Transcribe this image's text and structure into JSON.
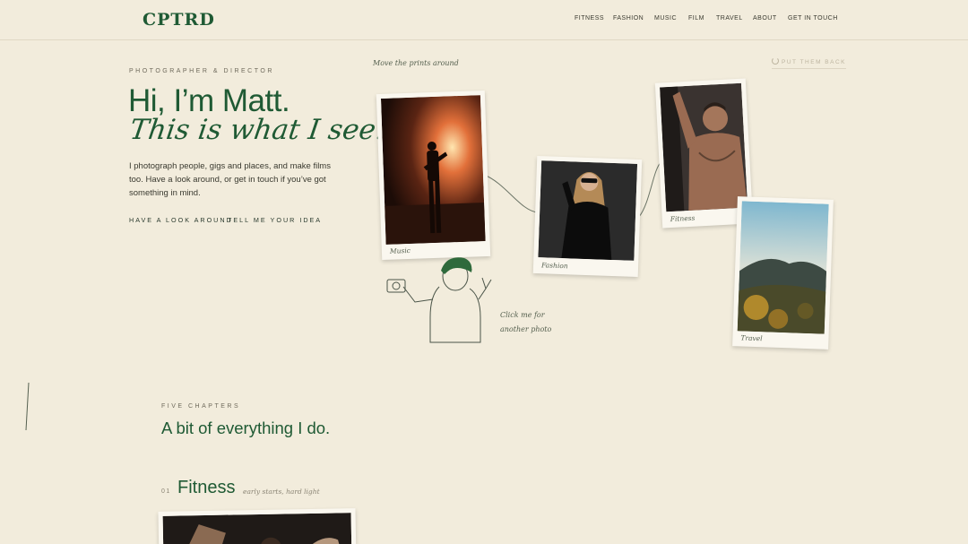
{
  "brand": {
    "logo": "CPTRD"
  },
  "nav": {
    "items": [
      {
        "label": "FITNESS"
      },
      {
        "label": "FASHION"
      },
      {
        "label": "MUSIC"
      },
      {
        "label": "FILM"
      },
      {
        "label": "TRAVEL"
      },
      {
        "label": "ABOUT"
      },
      {
        "label": "GET IN TOUCH"
      }
    ]
  },
  "hero": {
    "eyebrow": "PHOTOGRAPHER & DIRECTOR",
    "heading": "Hi, I’m Matt.",
    "script_heading": "This is what I see.",
    "intro": "I photograph people, gigs and places, and make films too. Have a look around, or get in touch if you’ve got something in mind.",
    "cta_primary": "HAVE A LOOK AROUND",
    "cta_secondary": "TELL ME YOUR IDEA"
  },
  "board": {
    "hint_move": "Move the prints around",
    "put_back": "PUT THEM BACK",
    "hint_click_1": "Click me for",
    "hint_click_2": "another photo",
    "prints": [
      {
        "caption": "Music"
      },
      {
        "caption": "Fashion"
      },
      {
        "caption": "Fitness"
      },
      {
        "caption": "Travel"
      }
    ]
  },
  "chapters": {
    "eyebrow": "FIVE CHAPTERS",
    "heading": "A bit of everything I do.",
    "first": {
      "number": "01",
      "title": "Fitness",
      "subtitle": "early starts, hard light"
    }
  },
  "colors": {
    "accent_green": "#1f5a34",
    "background": "#f2ecdc",
    "paper": "#faf7ef"
  }
}
